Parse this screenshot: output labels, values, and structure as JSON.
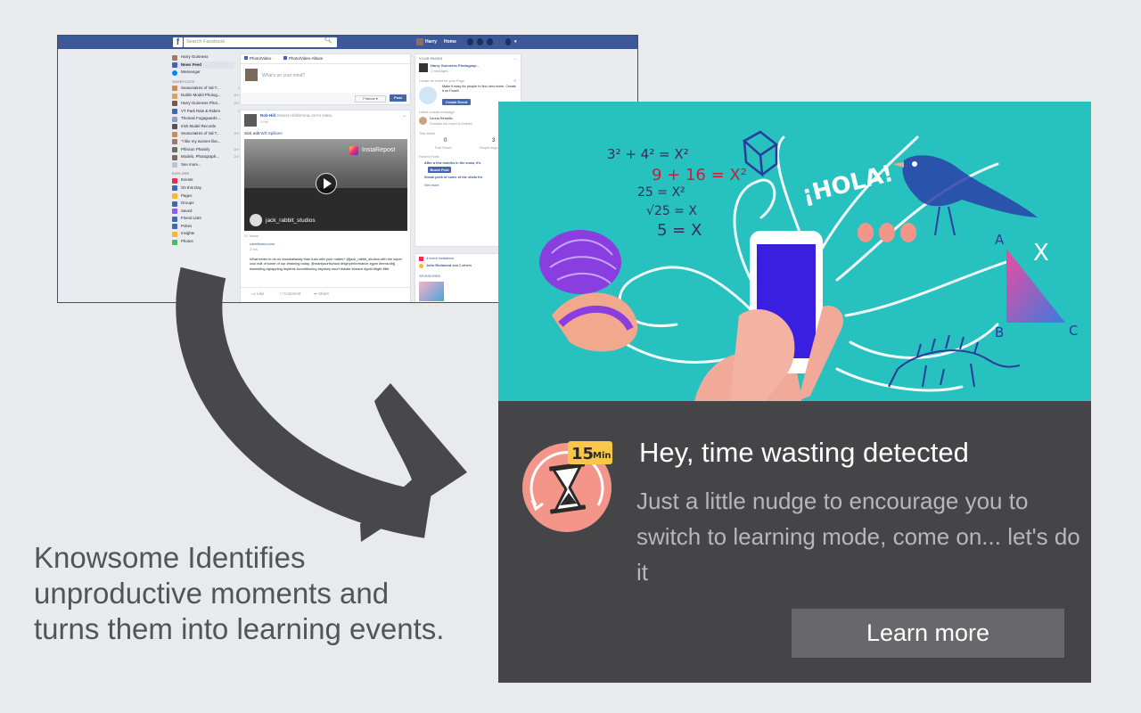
{
  "facebook": {
    "search_placeholder": "Search Facebook",
    "user_name": "Harry",
    "home_label": "Home",
    "left_nav": {
      "profile_name": "Harry Guinness",
      "news_feed": "News Feed",
      "messenger": "Messenger",
      "shortcuts_header": "SHORTCUTS",
      "shortcuts": [
        {
          "label": "Seasonaires of Val T...",
          "count": "2"
        },
        {
          "label": "Dublin Model Photog...",
          "count": "20+"
        },
        {
          "label": "Harry Guinness Phot...",
          "count": "20+"
        },
        {
          "label": "VT Park Rats & Riders",
          "count": "1"
        },
        {
          "label": "Thomas Fogaguards ...",
          "count": ""
        },
        {
          "label": "Irish Model Records",
          "count": ""
        },
        {
          "label": "Seasonaires of Val T...",
          "count": "20+"
        },
        {
          "label": "\"I like my women like...",
          "count": ""
        },
        {
          "label": "Phlsson Phamily",
          "count": "20+"
        },
        {
          "label": "Models, Photograph...",
          "count": "20+"
        }
      ],
      "see_more": "See more...",
      "explore_header": "EXPLORE",
      "explore": [
        "Events",
        "On this Day",
        "Pages",
        "Groups",
        "Saved",
        "Friend Lists",
        "Pokes",
        "Insights",
        "Photos"
      ]
    },
    "composer": {
      "tab_photo": "Photo/Video",
      "tab_album": "Photo/Video Album",
      "placeholder": "What's on your mind?",
      "audience": "Friends",
      "post_button": "Post"
    },
    "post": {
      "author": "Rob Hill",
      "shared_text": "shared robhillmma.com's video.",
      "time": "2 hrs",
      "caption_prefix": "Sick edit",
      "caption_link": "Will Spillane",
      "watermark": "InstaRepost",
      "video_credit": "jack_rabbit_studios",
      "views": "21 Views",
      "link_site": "robhillmma.com",
      "link_time": "2 hrs",
      "body": "What better to do on #australiaday than train with your mates? @jack_rabbit_studios with the super cool edit of some of our #training today. @manlysurfschool #highperformance #gym #mma #bjj #wrestling #grappling #sprints #conditioning #sydney #surf #skate #beach #gold #fight #life",
      "like": "Like",
      "comment": "Comment",
      "share": "Share"
    },
    "right_col": {
      "your_pages": "YOUR PAGES",
      "page_name": "Harry Guinness Photograp...",
      "page_messages": "2 messages",
      "event_prompt": "Create an event for your Page",
      "event_text": "Make it easy for people to find next event. Create it on Faceb",
      "create_event": "Create Event",
      "latest_unread": "Latest unread message",
      "see_all": "About a",
      "message_from": "Leona Kinsella",
      "message_text": "Dundalk but travel to Dublin!",
      "this_week": "This Week",
      "reach_value": "0",
      "reach_label": "Post Reach",
      "engage_value": "3",
      "engage_label": "People enga",
      "recent_posts": "Recent Posts",
      "recent_1": "After a few months in the snow, it's",
      "boost": "Boost Post",
      "recent_2": "Sneak peek of some of the shots fro",
      "see_more": "See more",
      "event_invites": "4 event invitations",
      "john": "John Redmond",
      "others": "and 2 others",
      "sponsored": "SPONSORED",
      "create": "Crea"
    }
  },
  "illustration": {
    "math_lines": [
      "3² + 4² = X²",
      "9 + 16 = X²",
      "25 = X²",
      "√25 = X",
      "5 = X"
    ],
    "hola": "¡HOLA!",
    "triangle_labels": [
      "A",
      "B",
      "C",
      "X"
    ]
  },
  "promo": {
    "badge_text": "15",
    "badge_unit": "Min",
    "title": "Hey, time wasting detected",
    "message": "Just a little nudge to encourage you to switch to learning mode, come on... let's do it",
    "button": "Learn more",
    "colors": {
      "panel": "#454547",
      "illustration_bg": "#27c1bf",
      "badge_circle": "#f4958a",
      "badge_tag": "#f7c64a",
      "button": "#68686a"
    }
  },
  "caption": "Knowsome Identifies unproductive moments and turns them into learning events."
}
